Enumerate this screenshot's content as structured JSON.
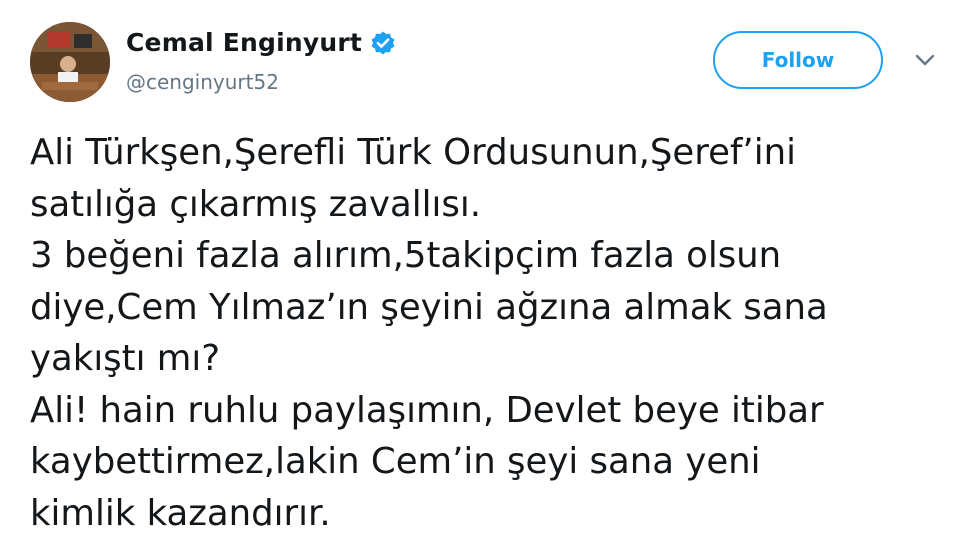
{
  "author": {
    "display_name": "Cemal Enginyurt",
    "handle": "@cenginyurt52",
    "verified": true,
    "avatar_icon": "profile-photo"
  },
  "actions": {
    "follow_label": "Follow",
    "more_icon": "chevron-down-icon"
  },
  "tweet": {
    "lines": [
      "Ali Türkşen,Şerefli Türk Ordusunun,Şeref’ini",
      "satılığa çıkarmış zavallısı.",
      "3 beğeni fazla alırım,5takipçim fazla olsun",
      "diye,Cem Yılmaz’ın şeyini ağzına almak sana",
      "yakıştı mı?",
      "Ali! hain ruhlu paylaşımın, Devlet beye itibar",
      "kaybettirmez,lakin Cem’in şeyi sana yeni",
      "kimlik kazandırır."
    ]
  },
  "colors": {
    "accent": "#1da1f2",
    "text": "#14171a",
    "secondary": "#657786"
  }
}
